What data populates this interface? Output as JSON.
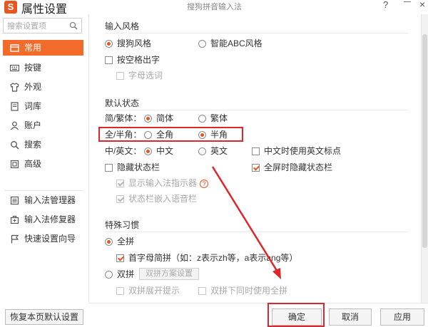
{
  "window": {
    "logo_letter": "S",
    "title": "属性设置",
    "app_name": "搜狗拼音输入法",
    "help": "?",
    "close": "×"
  },
  "sidebar": {
    "search_placeholder": "搜索设置项",
    "items": [
      {
        "label": "常用",
        "icon": "home-icon",
        "active": true
      },
      {
        "label": "按键",
        "icon": "keyboard-icon"
      },
      {
        "label": "外观",
        "icon": "shirt-icon"
      },
      {
        "label": "词库",
        "icon": "book-icon"
      },
      {
        "label": "账户",
        "icon": "user-icon"
      },
      {
        "label": "搜索",
        "icon": "search-icon"
      },
      {
        "label": "高级",
        "icon": "advanced-icon"
      }
    ],
    "tools": [
      {
        "label": "输入法管理器",
        "icon": "manager-icon"
      },
      {
        "label": "输入法修复器",
        "icon": "repair-icon"
      },
      {
        "label": "快速设置向导",
        "icon": "flag-icon"
      }
    ],
    "restore_label": "恢复本页默认设置"
  },
  "input_style": {
    "title": "输入风格",
    "sogou": "搜狗风格",
    "abc": "智能ABC风格",
    "space_output": "按空格出字",
    "letter_select": "字母选词"
  },
  "default_state": {
    "title": "默认状态",
    "simp_trad_label": "简/繁体：",
    "simplified": "简体",
    "traditional": "繁体",
    "width_label": "全/半角：",
    "full_width": "全角",
    "half_width": "半角",
    "cn_en_label": "中/英文：",
    "chinese": "中文",
    "english": "英文",
    "cn_use_en_punct": "中文时使用英文标点",
    "hide_status_bar": "隐藏状态栏",
    "fullscreen_hide": "全屏时隐藏状态栏",
    "show_indicator": "显示输入法指示器",
    "embed_voice": "状态栏嵌入语音栏"
  },
  "special_habits": {
    "title": "特殊习惯",
    "full_pinyin": "全拼",
    "initial_abbrev": "首字母简拼（如：z表示zh等，a表示ang等）",
    "double_pinyin": "双拼",
    "double_scheme_btn": "双拼方案设置",
    "double_expand_hint": "双拼展开提示",
    "double_with_full": "双拼下同时使用全拼"
  },
  "footer": {
    "ok": "确定",
    "cancel": "取消",
    "apply": "应用"
  }
}
